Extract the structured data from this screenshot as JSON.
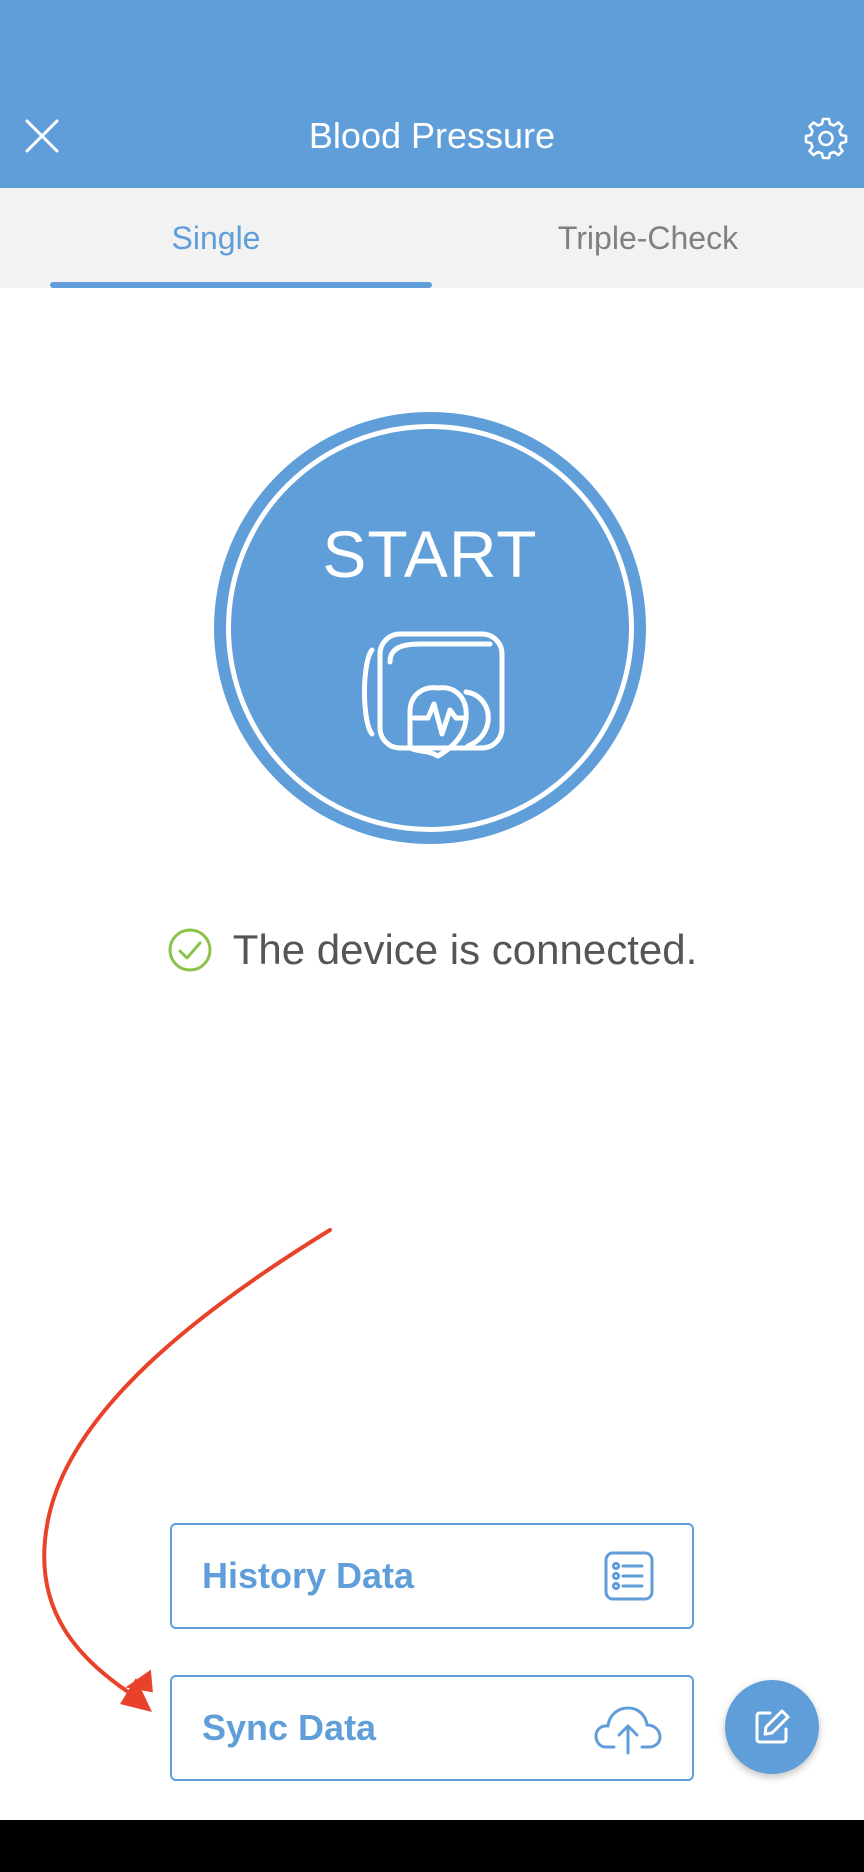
{
  "header": {
    "title": "Blood Pressure",
    "close_icon": "close-icon",
    "settings_icon": "gear-icon"
  },
  "tabs": [
    {
      "label": "Single",
      "selected": true
    },
    {
      "label": "Triple-Check",
      "selected": false
    }
  ],
  "start": {
    "label": "START",
    "icon": "blood-pressure-cuff-icon"
  },
  "status": {
    "text": "The device is connected.",
    "icon": "check-circle-icon"
  },
  "actions": {
    "history": {
      "label": "History Data",
      "icon": "list-icon"
    },
    "sync": {
      "label": "Sync Data",
      "icon": "cloud-upload-icon"
    }
  },
  "fab": {
    "icon": "edit-icon"
  },
  "colors": {
    "primary": "#5f9ed8",
    "tab_background": "#f2f2f2",
    "status_check": "#8bc34a",
    "annotation_arrow": "#e8432a",
    "text_gray": "#555555"
  }
}
